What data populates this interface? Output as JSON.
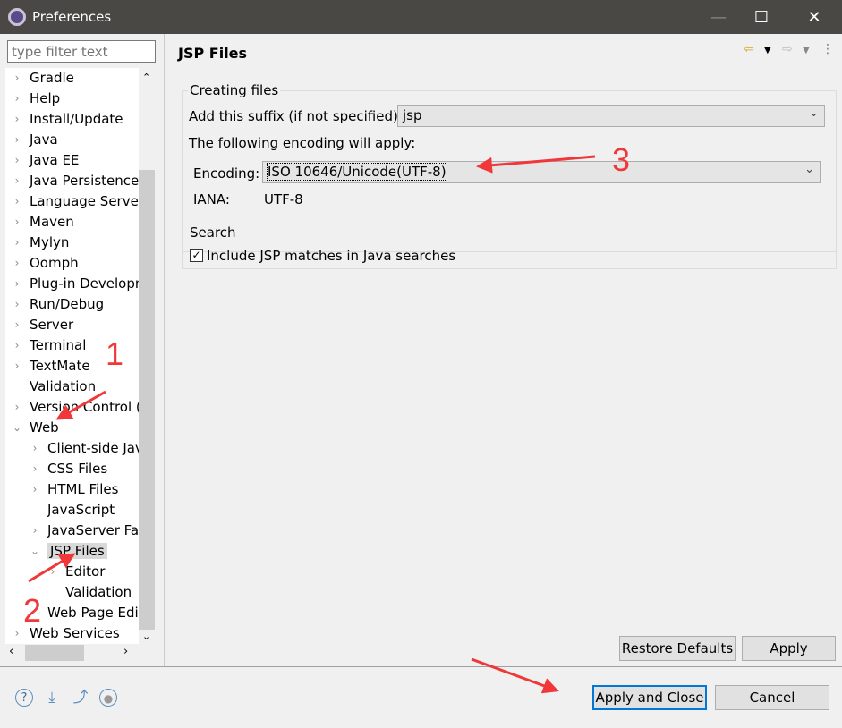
{
  "window": {
    "title": "Preferences",
    "minimize": "—",
    "maximize": "☐",
    "close": "✕"
  },
  "sidebar": {
    "filter_placeholder": "type filter text",
    "items": [
      {
        "label": "Gradle",
        "level": 0,
        "arrow": "›"
      },
      {
        "label": "Help",
        "level": 0,
        "arrow": "›"
      },
      {
        "label": "Install/Update",
        "level": 0,
        "arrow": "›"
      },
      {
        "label": "Java",
        "level": 0,
        "arrow": "›"
      },
      {
        "label": "Java EE",
        "level": 0,
        "arrow": "›"
      },
      {
        "label": "Java Persistence",
        "level": 0,
        "arrow": "›"
      },
      {
        "label": "Language Servers",
        "level": 0,
        "arrow": "›"
      },
      {
        "label": "Maven",
        "level": 0,
        "arrow": "›"
      },
      {
        "label": "Mylyn",
        "level": 0,
        "arrow": "›"
      },
      {
        "label": "Oomph",
        "level": 0,
        "arrow": "›"
      },
      {
        "label": "Plug-in Development",
        "level": 0,
        "arrow": "›"
      },
      {
        "label": "Run/Debug",
        "level": 0,
        "arrow": "›"
      },
      {
        "label": "Server",
        "level": 0,
        "arrow": "›"
      },
      {
        "label": "Terminal",
        "level": 0,
        "arrow": "›"
      },
      {
        "label": "TextMate",
        "level": 0,
        "arrow": "›"
      },
      {
        "label": "Validation",
        "level": 0,
        "arrow": ""
      },
      {
        "label": "Version Control (Team)",
        "level": 0,
        "arrow": "›"
      },
      {
        "label": "Web",
        "level": 0,
        "arrow": "⌄"
      },
      {
        "label": "Client-side JavaScript",
        "level": 1,
        "arrow": "›"
      },
      {
        "label": "CSS Files",
        "level": 1,
        "arrow": "›"
      },
      {
        "label": "HTML Files",
        "level": 1,
        "arrow": "›"
      },
      {
        "label": "JavaScript",
        "level": 1,
        "arrow": ""
      },
      {
        "label": "JavaServer Faces Tools",
        "level": 1,
        "arrow": "›"
      },
      {
        "label": "JSP Files",
        "level": 1,
        "arrow": "⌄",
        "selected": true
      },
      {
        "label": "Editor",
        "level": 2,
        "arrow": "›"
      },
      {
        "label": "Validation",
        "level": 2,
        "arrow": ""
      },
      {
        "label": "Web Page Editor",
        "level": 1,
        "arrow": ""
      },
      {
        "label": "Web Services",
        "level": 0,
        "arrow": "›"
      }
    ]
  },
  "main": {
    "title": "JSP Files",
    "creating": {
      "legend": "Creating files",
      "suffix_label": "Add this suffix (if not specified):",
      "suffix_value": "jsp",
      "encoding_note": "The following encoding will apply:",
      "encoding_label": "Encoding:",
      "encoding_value": "ISO 10646/Unicode(UTF-8)",
      "iana_label": "IANA:",
      "iana_value": "UTF-8"
    },
    "search": {
      "legend": "Search",
      "checkbox_label": "Include JSP matches in Java searches",
      "checked": true
    },
    "restore_defaults": "Restore Defaults",
    "apply": "Apply"
  },
  "footer": {
    "apply_close": "Apply and Close",
    "cancel": "Cancel"
  },
  "annotations": {
    "n1": "1",
    "n2": "2",
    "n3": "3",
    "color": "#f0373a"
  }
}
